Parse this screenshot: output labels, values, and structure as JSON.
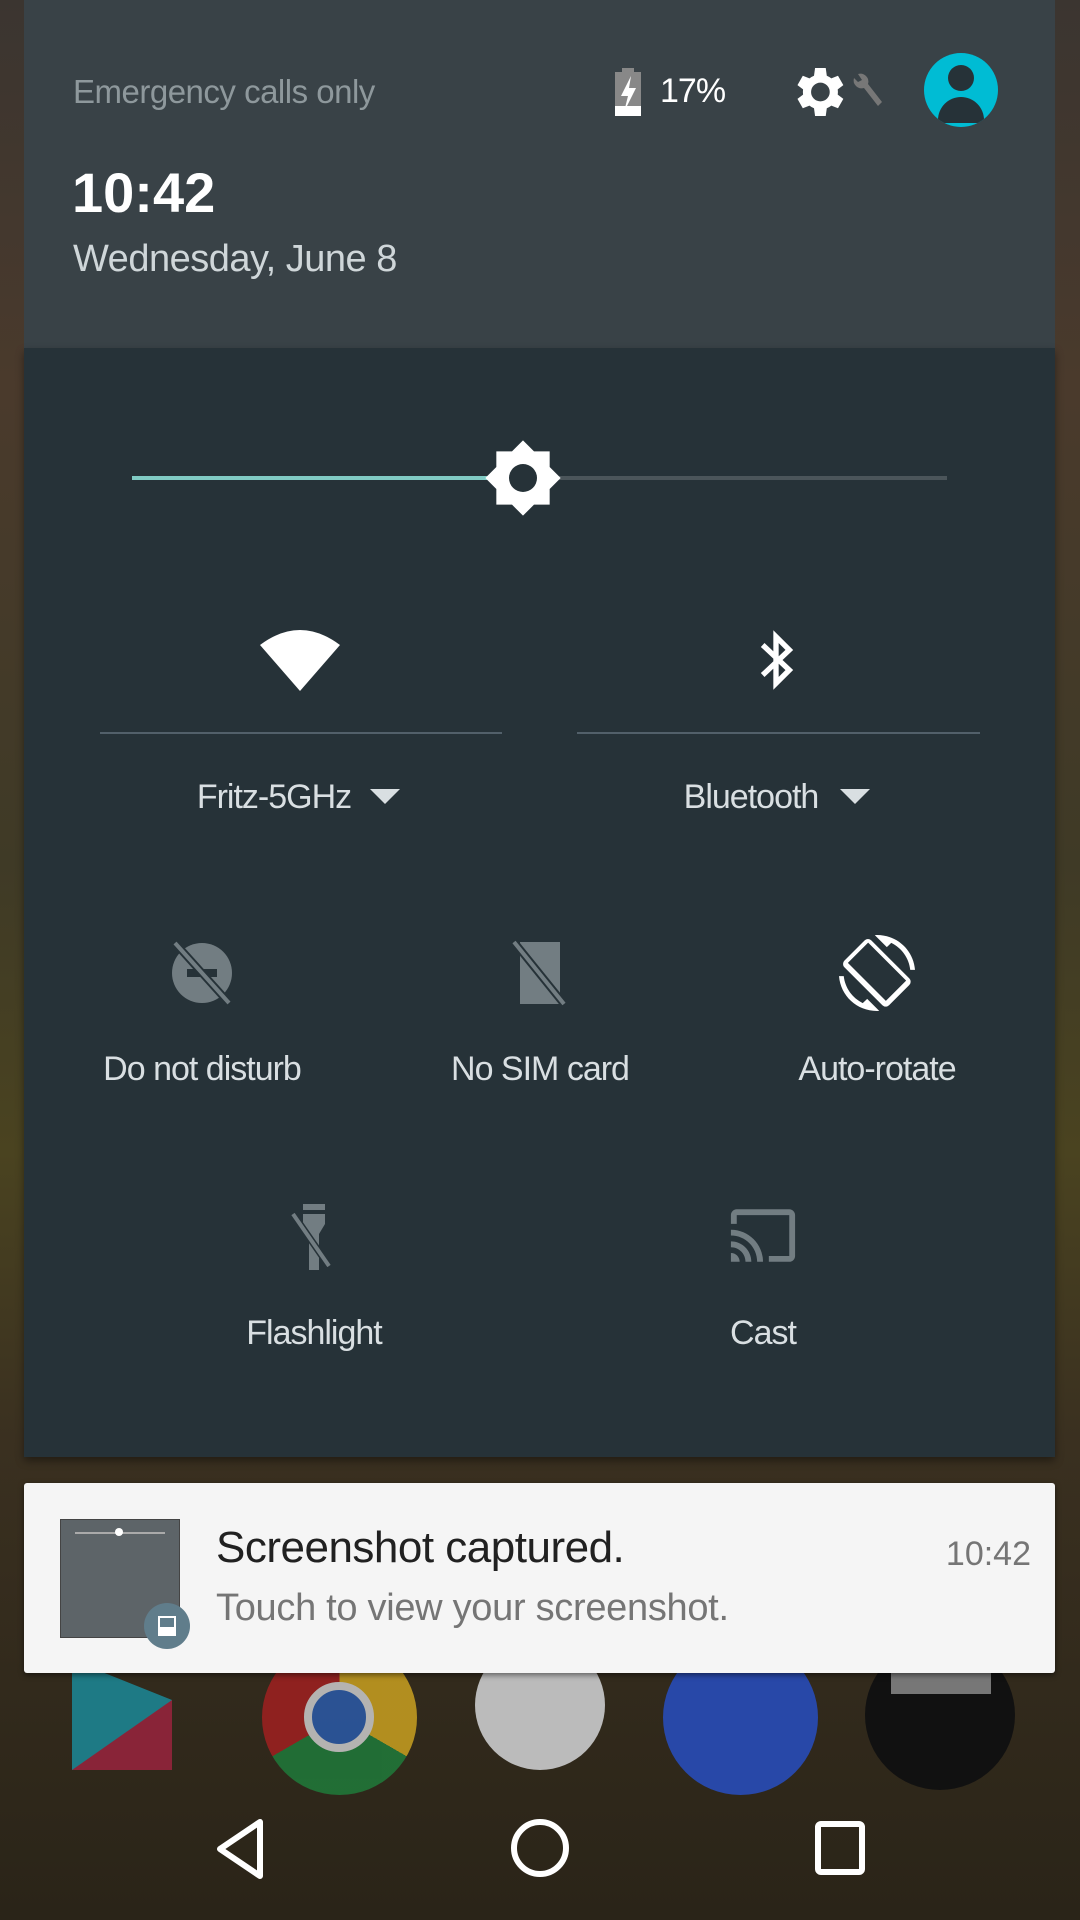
{
  "status": {
    "carrier_text": "Emergency calls only",
    "battery_percent": "17%",
    "battery_level": 17,
    "time": "10:42",
    "date": "Wednesday, June 8"
  },
  "colors": {
    "accent": "#80cbc4",
    "avatar": "#00bcd4",
    "panel": "#263238",
    "header": "#394247"
  },
  "brightness": {
    "level_percent": 48
  },
  "tiles": {
    "wifi": {
      "label": "Fritz-5GHz",
      "icon": "wifi-icon"
    },
    "bluetooth": {
      "label": "Bluetooth",
      "icon": "bluetooth-icon"
    },
    "dnd": {
      "label": "Do not disturb",
      "icon": "do-not-disturb-off-icon"
    },
    "sim": {
      "label": "No SIM card",
      "icon": "no-sim-icon"
    },
    "rotate": {
      "label": "Auto-rotate",
      "icon": "screen-rotation-icon"
    },
    "flashlight": {
      "label": "Flashlight",
      "icon": "flashlight-off-icon"
    },
    "cast": {
      "label": "Cast",
      "icon": "cast-icon"
    }
  },
  "notification": {
    "title": "Screenshot captured.",
    "text": "Touch to view your screenshot.",
    "time": "10:42"
  },
  "nav": {
    "back": "back-icon",
    "home": "home-icon",
    "recents": "recents-icon"
  }
}
